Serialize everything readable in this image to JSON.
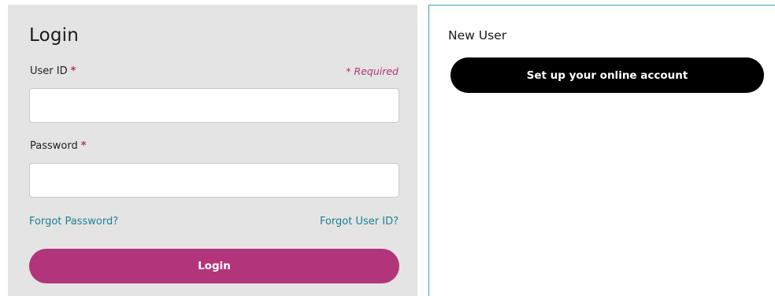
{
  "login": {
    "title": "Login",
    "user_id_label": "User ID",
    "password_label": "Password",
    "required_star": "*",
    "required_note": "* Required",
    "user_id_value": "",
    "password_value": "",
    "forgot_password": "Forgot Password?",
    "forgot_user_id": "Forgot User ID?",
    "login_button": "Login"
  },
  "new_user": {
    "title": "New User",
    "setup_button": "Set up your online account"
  },
  "colors": {
    "accent": "#b2357b",
    "link": "#1f7f96",
    "panel_bg": "#e3e4e3",
    "border": "#3fa3bd"
  }
}
